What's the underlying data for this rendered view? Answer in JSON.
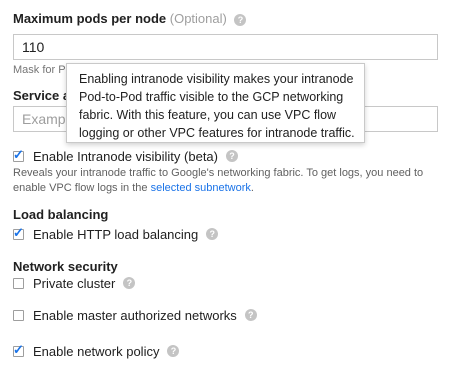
{
  "max_pods": {
    "label": "Maximum pods per node",
    "optional": "(Optional)",
    "value": "110",
    "hint_visible": "Mask for Pod address range per node: /24"
  },
  "service_address": {
    "label": "Service address range",
    "placeholder": "Example: 10.0.0.0/20"
  },
  "tooltip": {
    "text": "Enabling intranode visibility makes your intranode Pod-to-Pod traffic visible to the GCP networking fabric. With this feature, you can use VPC flow logging or other VPC features for intranode traffic."
  },
  "intranode": {
    "label": "Enable Intranode visibility (beta)",
    "checked": true,
    "description_line1": "Reveals your intranode traffic to Google's networking fabric. To get logs, you need to",
    "description_line2_pre": "enable VPC flow logs in the ",
    "description_link": "selected subnetwork",
    "description_line2_post": "."
  },
  "load_balancing": {
    "heading": "Load balancing",
    "http_label": "Enable HTTP load balancing",
    "http_checked": true
  },
  "network_security": {
    "heading": "Network security",
    "private_cluster_label": "Private cluster",
    "private_cluster_checked": false,
    "master_auth_label": "Enable master authorized networks",
    "master_auth_checked": false,
    "network_policy_label": "Enable network policy",
    "network_policy_checked": true
  },
  "icons": {
    "help": "help-circle-icon",
    "check": "checkmark-icon"
  },
  "colors": {
    "link": "#1a73e8",
    "checkbox_check": "#1a73e8",
    "help_icon": "#c4c4c4"
  }
}
